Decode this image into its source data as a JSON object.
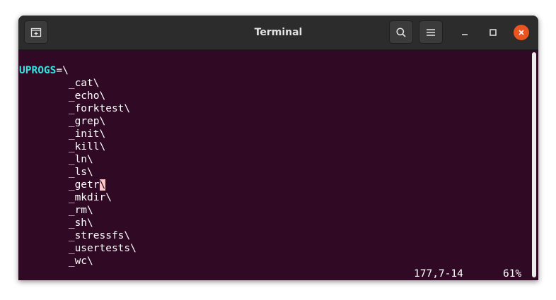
{
  "window": {
    "title": "Terminal"
  },
  "icons": {
    "new_tab": "new-tab-icon",
    "search": "search-icon",
    "menu": "hamburger-menu-icon",
    "minimize": "minimize-icon",
    "maximize": "maximize-icon",
    "close": "close-icon"
  },
  "colors": {
    "titlebar": "#2c2c2c",
    "terminal_bg": "#300a24",
    "variable": "#34e2e2",
    "cursor": "#ffc8c8",
    "close_button": "#e95420"
  },
  "editor": {
    "variable": "UPROGS",
    "assign": "=\\",
    "entries": [
      "_cat\\",
      "_echo\\",
      "_forktest\\",
      "_grep\\",
      "_init\\",
      "_kill\\",
      "_ln\\",
      "_ls\\",
      "_getr",
      "_mkdir\\",
      "_rm\\",
      "_sh\\",
      "_stressfs\\",
      "_usertests\\",
      "_wc\\"
    ],
    "cursor_char": "\\",
    "status_position": "177,7-14",
    "status_percent": "61%"
  }
}
